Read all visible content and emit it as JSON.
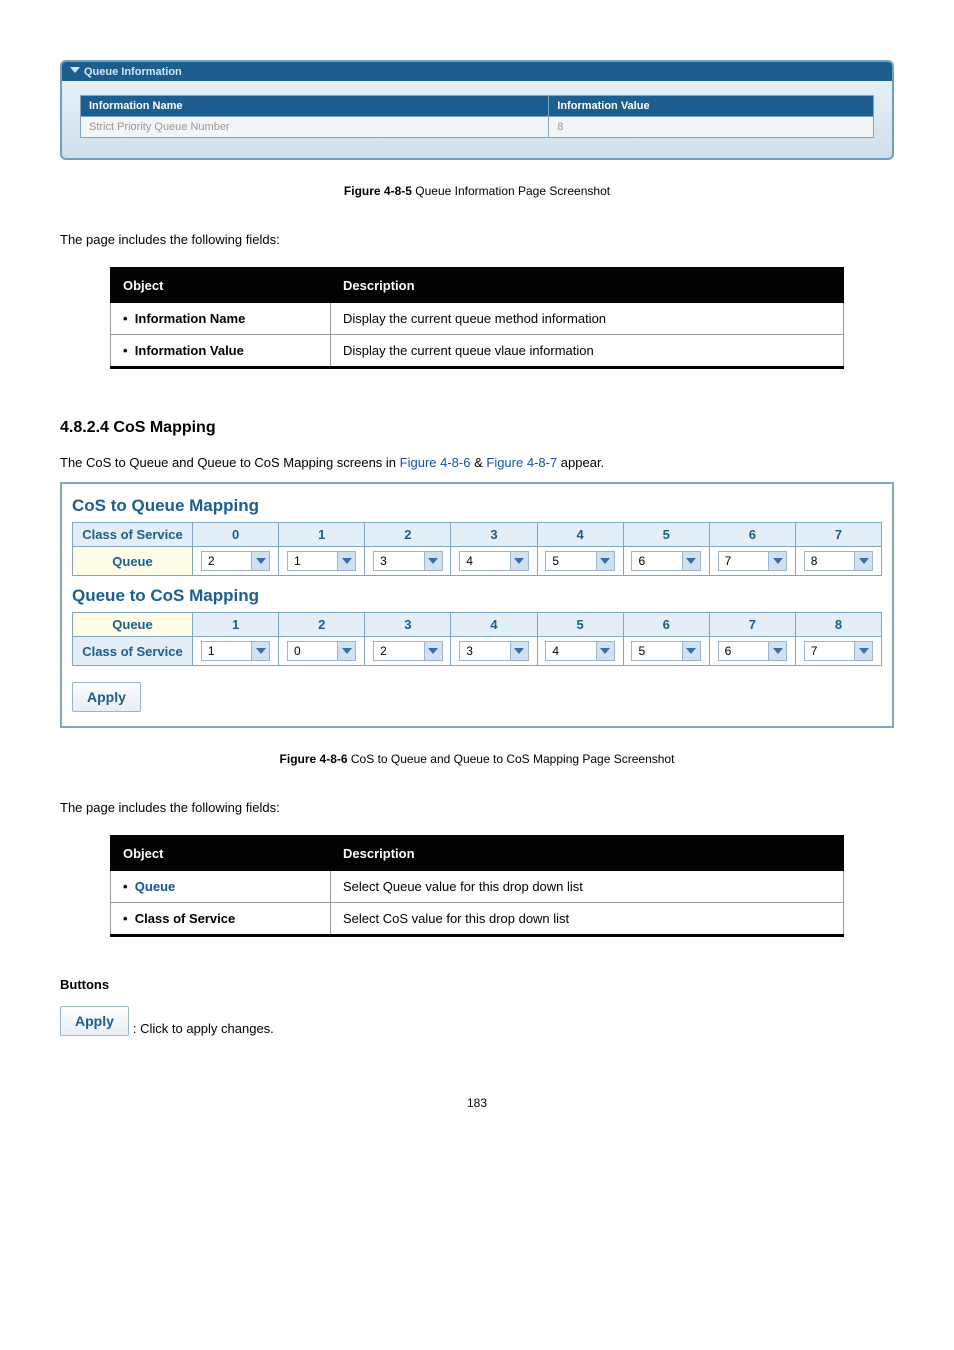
{
  "queue_info": {
    "panel_title": "Queue Information",
    "headers": {
      "name": "Information Name",
      "value": "Information Value"
    },
    "rows": [
      {
        "name": "Strict Priority Queue Number",
        "value": "8"
      }
    ]
  },
  "figure_4_8_5": {
    "label": "Figure 4-8-5",
    "text": "Queue Information Page Screenshot"
  },
  "page_includes": "The page includes the following fields:",
  "table1": {
    "headers": {
      "object": "Object",
      "description": "Description"
    },
    "rows": [
      {
        "object": "Information Name",
        "description": "Display the current queue method information"
      },
      {
        "object": "Information Value",
        "description": "Display the current queue vlaue information"
      }
    ]
  },
  "section": {
    "number": "4.8.2.4",
    "title": "CoS Mapping",
    "intro_prefix": "The CoS to Queue and Queue to CoS Mapping screens in ",
    "link1": "Figure 4-8-6",
    "amp": " & ",
    "link2": "Figure 4-8-7",
    "intro_suffix": " appear."
  },
  "cos_to_queue": {
    "title": "CoS to Queue Mapping",
    "row_header": "Class of Service",
    "row_label": "Queue",
    "cols": [
      "0",
      "1",
      "2",
      "3",
      "4",
      "5",
      "6",
      "7"
    ],
    "values": [
      "2",
      "1",
      "3",
      "4",
      "5",
      "6",
      "7",
      "8"
    ]
  },
  "queue_to_cos": {
    "title": "Queue to CoS Mapping",
    "row_header": "Queue",
    "row_label": "Class of Service",
    "cols": [
      "1",
      "2",
      "3",
      "4",
      "5",
      "6",
      "7",
      "8"
    ],
    "values": [
      "1",
      "0",
      "2",
      "3",
      "4",
      "5",
      "6",
      "7"
    ]
  },
  "apply_label": "Apply",
  "figure_4_8_6": {
    "label": "Figure 4-8-6",
    "text": "CoS to Queue and Queue to CoS Mapping Page Screenshot"
  },
  "table2": {
    "headers": {
      "object": "Object",
      "description": "Description"
    },
    "rows": [
      {
        "object": "Queue",
        "description": "Select Queue value for this drop down list",
        "blue": true
      },
      {
        "object": "Class of Service",
        "description": "Select CoS value for this drop down list",
        "blue": false
      }
    ]
  },
  "buttons": {
    "heading": "Buttons",
    "apply": "Apply",
    "apply_desc": ": Click to apply changes."
  },
  "page_number": "183"
}
